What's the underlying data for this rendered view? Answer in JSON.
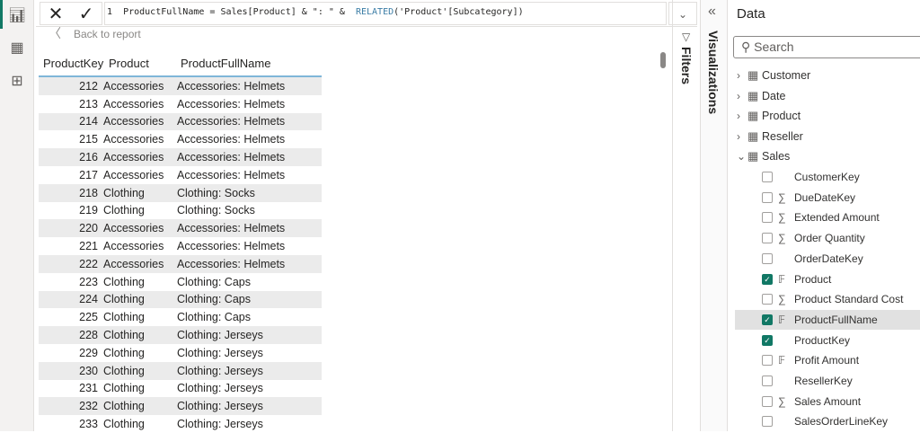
{
  "formula_bar": {
    "line_number": "1",
    "expr_part1": "ProductFullName = Sales[Product] & \": \" &  ",
    "expr_fn": "RELATED",
    "expr_part2": "('Product'[Subcategory])",
    "cancel_icon": "✕",
    "commit_icon": "✓"
  },
  "back_label": "Back to report",
  "table": {
    "headers": [
      "ProductKey",
      "Product",
      "ProductFullName"
    ],
    "rows": [
      [
        "212",
        "Accessories",
        "Accessories: Helmets"
      ],
      [
        "213",
        "Accessories",
        "Accessories: Helmets"
      ],
      [
        "214",
        "Accessories",
        "Accessories: Helmets"
      ],
      [
        "215",
        "Accessories",
        "Accessories: Helmets"
      ],
      [
        "216",
        "Accessories",
        "Accessories: Helmets"
      ],
      [
        "217",
        "Accessories",
        "Accessories: Helmets"
      ],
      [
        "218",
        "Clothing",
        "Clothing: Socks"
      ],
      [
        "219",
        "Clothing",
        "Clothing: Socks"
      ],
      [
        "220",
        "Accessories",
        "Accessories: Helmets"
      ],
      [
        "221",
        "Accessories",
        "Accessories: Helmets"
      ],
      [
        "222",
        "Accessories",
        "Accessories: Helmets"
      ],
      [
        "223",
        "Clothing",
        "Clothing: Caps"
      ],
      [
        "224",
        "Clothing",
        "Clothing: Caps"
      ],
      [
        "225",
        "Clothing",
        "Clothing: Caps"
      ],
      [
        "228",
        "Clothing",
        "Clothing: Jerseys"
      ],
      [
        "229",
        "Clothing",
        "Clothing: Jerseys"
      ],
      [
        "230",
        "Clothing",
        "Clothing: Jerseys"
      ],
      [
        "231",
        "Clothing",
        "Clothing: Jerseys"
      ],
      [
        "232",
        "Clothing",
        "Clothing: Jerseys"
      ],
      [
        "233",
        "Clothing",
        "Clothing: Jerseys"
      ]
    ]
  },
  "filters_label": "Filters",
  "visualizations_label": "Visualizations",
  "data_pane": {
    "title": "Data",
    "search_placeholder": "Search",
    "tables": [
      "Customer",
      "Date",
      "Product",
      "Reseller",
      "Sales"
    ],
    "fields": [
      {
        "name": "CustomerKey",
        "checked": false,
        "icon": ""
      },
      {
        "name": "DueDateKey",
        "checked": false,
        "icon": "∑"
      },
      {
        "name": "Extended Amount",
        "checked": false,
        "icon": "∑"
      },
      {
        "name": "Order Quantity",
        "checked": false,
        "icon": "∑"
      },
      {
        "name": "OrderDateKey",
        "checked": false,
        "icon": ""
      },
      {
        "name": "Product",
        "checked": true,
        "icon": "calc-column"
      },
      {
        "name": "Product Standard Cost",
        "checked": false,
        "icon": "∑"
      },
      {
        "name": "ProductFullName",
        "checked": true,
        "icon": "calc-column",
        "selected": true
      },
      {
        "name": "ProductKey",
        "checked": true,
        "icon": ""
      },
      {
        "name": "Profit Amount",
        "checked": false,
        "icon": "calc-column"
      },
      {
        "name": "ResellerKey",
        "checked": false,
        "icon": ""
      },
      {
        "name": "Sales Amount",
        "checked": false,
        "icon": "∑"
      },
      {
        "name": "SalesOrderLineKey",
        "checked": false,
        "icon": ""
      }
    ]
  },
  "colors": {
    "accent": "#117865",
    "header_underline": "#7fb6d8",
    "alt_row": "#ebebeb"
  }
}
